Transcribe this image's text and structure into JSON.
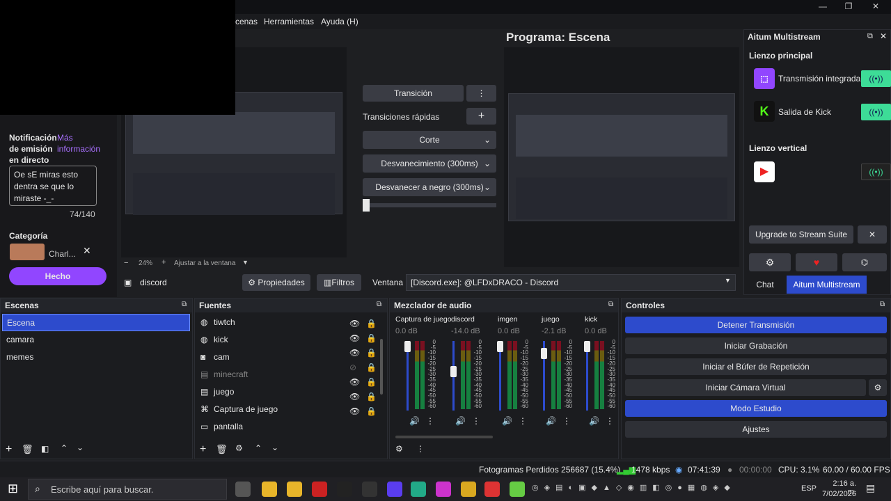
{
  "menu": {
    "scenes": "cenas",
    "tools": "Herramientas",
    "help": "Ayuda (H)"
  },
  "preview": {
    "program_title": "Programa: Escena",
    "zoom": "24%",
    "fit": "Ajustar a la ventana"
  },
  "transitions": {
    "transition": "Transición",
    "quick": "Transiciones rápidas",
    "cut": "Corte",
    "fade": "Desvanecimiento (300ms)",
    "fade_black": "Desvanecer a negro (300ms)"
  },
  "twitch": {
    "notif_title": "Notificación de emisión en directo",
    "more_info": "Más información",
    "stream_text": "Oe sE miras esto dentra se que lo miraste -_-",
    "counter": "74/140",
    "category_label": "Categoría",
    "category_value": "Charl...",
    "done": "Hecho"
  },
  "multistream": {
    "title": "Aitum Multistream",
    "main_canvas": "Lienzo principal",
    "integrated": "Transmisión integrada",
    "kick_out": "Salida de Kick",
    "vertical_canvas": "Lienzo vertical",
    "upgrade": "Upgrade to Stream Suite",
    "tab_chat": "Chat",
    "tab_aitum": "Aitum Multistream"
  },
  "sourcebar": {
    "name": "discord",
    "props": "Propiedades",
    "filters": "Filtros",
    "window_label": "Ventana",
    "window_value": "[Discord.exe]: @LFDxDRACO - Discord"
  },
  "scenes": {
    "title": "Escenas",
    "items": [
      "Escena",
      "camara",
      "memes"
    ]
  },
  "sources": {
    "title": "Fuentes",
    "items": [
      "tiwtch",
      "kick",
      "cam",
      "minecraft",
      "juego",
      "Captura de juego",
      "pantalla"
    ]
  },
  "mixer": {
    "title": "Mezclador de audio",
    "channels": [
      {
        "name": "Captura de juego",
        "db": "0.0 dB"
      },
      {
        "name": "discord",
        "db": "-14.0 dB"
      },
      {
        "name": "imgen",
        "db": "0.0 dB"
      },
      {
        "name": "juego",
        "db": "-2.1 dB"
      },
      {
        "name": "kick",
        "db": "0.0 dB"
      }
    ],
    "scale": [
      "0",
      "-5",
      "-10",
      "-15",
      "-20",
      "-25",
      "-30",
      "-35",
      "-40",
      "-45",
      "-50",
      "-55",
      "-60"
    ]
  },
  "controls": {
    "title": "Controles",
    "stop": "Detener Transmisión",
    "record": "Iniciar Grabación",
    "replay": "Iniciar el Búfer de Repetición",
    "vcam": "Iniciar Cámara Virtual",
    "studio": "Modo Estudio",
    "settings": "Ajustes"
  },
  "status": {
    "dropped": "Fotogramas Perdidos 256687 (15.4%)",
    "kbps": "1478 kbps",
    "live_time": "07:41:39",
    "rec_time": "00:00:00",
    "cpu": "CPU: 3.1%",
    "fps": "60.00 / 60.00 FPS"
  },
  "taskbar": {
    "search": "Escribe aquí para buscar.",
    "lang": "ESP",
    "time": "2:16 a. m.",
    "date": "7/02/2026"
  },
  "colors": {
    "accent": "#2d4bcc",
    "twitch": "#9146ff",
    "kick": "#53fc18",
    "live": "#3ddc97"
  }
}
